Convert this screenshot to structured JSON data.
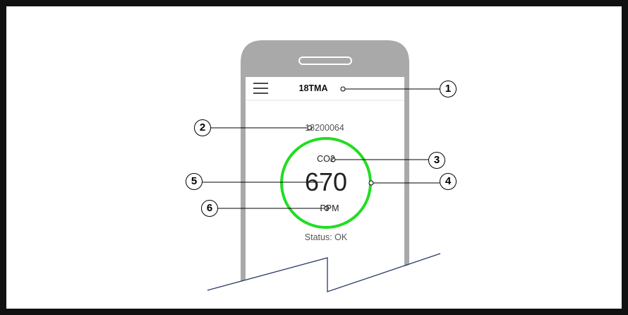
{
  "app": {
    "device_name": "18TMA",
    "serial": "18200064",
    "gas_label": "CO2",
    "reading": "670",
    "unit": "PPM",
    "status": "Status: OK"
  },
  "icons": {
    "menu": "hamburger-menu-icon"
  },
  "callouts": [
    "1",
    "2",
    "3",
    "4",
    "5",
    "6"
  ],
  "colors": {
    "ring": "#22dd22",
    "phone_body": "#a9a9a9",
    "leader_line": "#000000",
    "break_line": "#2b3a67"
  }
}
